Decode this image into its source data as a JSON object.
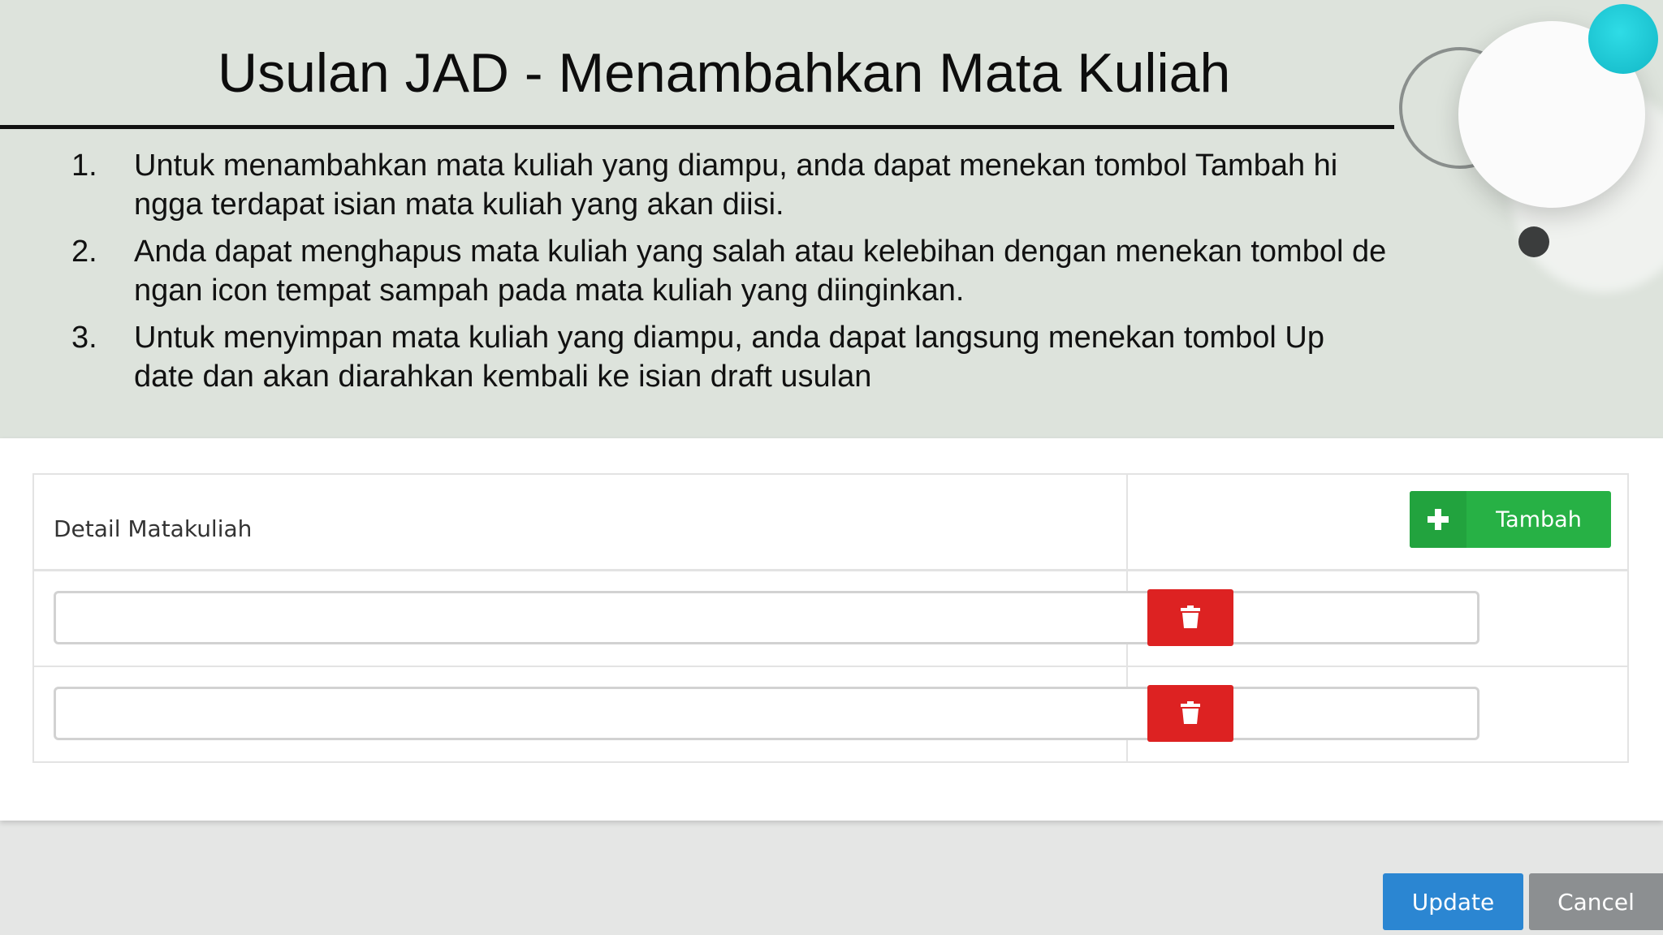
{
  "slide": {
    "title": "Usulan JAD - Menambahkan Mata Kuliah",
    "steps": [
      {
        "number": "1.",
        "text": "Untuk menambahkan mata kuliah yang diampu, anda dapat menekan tombol          Tambah hi\nngga terdapat isian mata kuliah yang akan diisi."
      },
      {
        "number": "2.",
        "text": "Anda dapat menghapus mata kuliah yang salah atau kelebihan dengan menekan     tombol de\nngan icon tempat sampah pada mata kuliah yang diinginkan."
      },
      {
        "number": "3.",
        "text": "Untuk menyimpan mata kuliah yang diampu, anda dapat langsung menekan           tombol Up\ndate dan akan diarahkan kembali ke isian draft usulan"
      }
    ]
  },
  "form": {
    "header_label": "Detail Matakuliah",
    "add_button_label": "Tambah",
    "add_button_icon": "plus-icon",
    "delete_button_icon": "trash-icon",
    "rows": [
      {
        "value": ""
      },
      {
        "value": ""
      }
    ]
  },
  "footer": {
    "update_label": "Update",
    "cancel_label": "Cancel"
  },
  "colors": {
    "slide_background": "#dde3dc",
    "add_button": "#27b145",
    "delete_button": "#dd2222",
    "update_button": "#2b86d2",
    "cancel_button": "#8c8f91",
    "accent_cyan": "#12b7c6"
  }
}
